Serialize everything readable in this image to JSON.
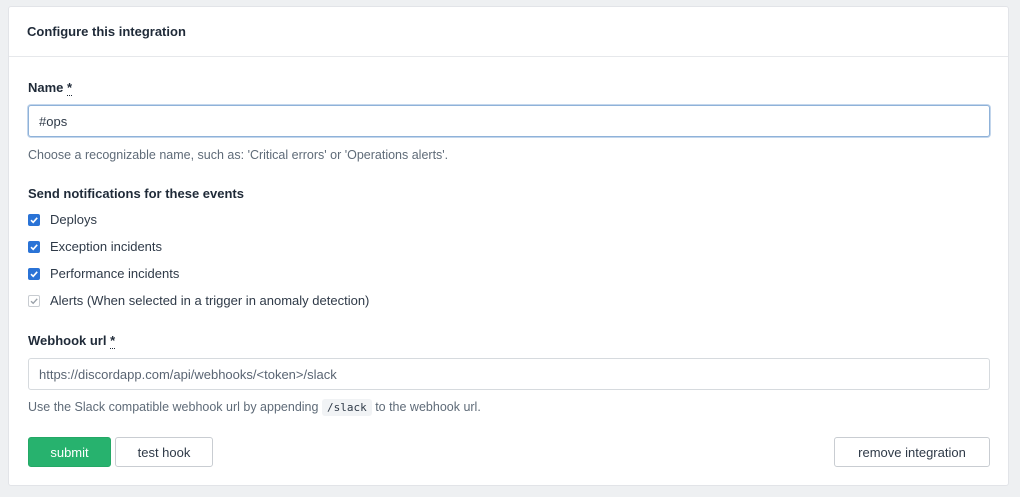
{
  "card": {
    "title": "Configure this integration"
  },
  "name_field": {
    "label": "Name",
    "required_marker": "*",
    "value": "#ops",
    "help": "Choose a recognizable name, such as: 'Critical errors' or 'Operations alerts'."
  },
  "events": {
    "label": "Send notifications for these events",
    "items": [
      {
        "label": "Deploys",
        "checked": true,
        "disabled": false
      },
      {
        "label": "Exception incidents",
        "checked": true,
        "disabled": false
      },
      {
        "label": "Performance incidents",
        "checked": true,
        "disabled": false
      },
      {
        "label": "Alerts (When selected in a trigger in anomaly detection)",
        "checked": true,
        "disabled": true
      }
    ]
  },
  "webhook_field": {
    "label": "Webhook url",
    "required_marker": "*",
    "placeholder": "https://discordapp.com/api/webhooks/<token>/slack",
    "help_before": "Use the Slack compatible webhook url by appending",
    "help_code": "/slack",
    "help_after": "to the webhook url."
  },
  "actions": {
    "submit_label": "submit",
    "test_label": "test hook",
    "remove_label": "remove integration"
  },
  "colors": {
    "primary_green": "#27b26e",
    "checkbox_blue": "#2a73d6"
  }
}
